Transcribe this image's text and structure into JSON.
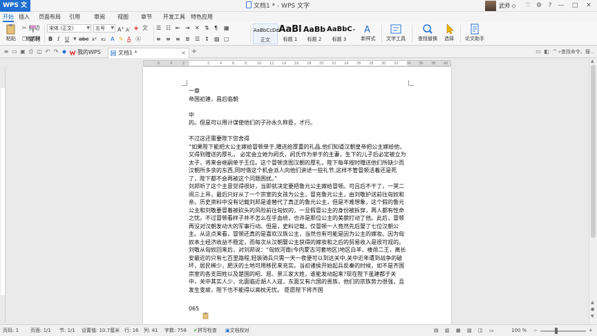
{
  "titlebar": {
    "app_menu": "WPS 文字",
    "doc_title": "文档1 * - WPS 文字",
    "username": "武师 ◇"
  },
  "menu": {
    "tabs": [
      "开始",
      "插入",
      "页面布局",
      "引用",
      "审阅",
      "视图",
      "章节",
      "开发工具",
      "特色应用"
    ],
    "active_index": 0
  },
  "ribbon": {
    "paste_label": "粘贴",
    "cut_label": "剪切",
    "copy_label": "复制",
    "format_painter_label": "格式刷",
    "font_name": "宋体 (正文)",
    "font_size": "五号",
    "styles": [
      {
        "sample": "AaBbCcDd",
        "label": "正文"
      },
      {
        "sample": "AaBl",
        "label": "标题 1"
      },
      {
        "sample": "AaBb",
        "label": "标题 2"
      },
      {
        "sample": "AaBbC",
        "label": "标题 3"
      }
    ],
    "new_style_label": "新样式",
    "text_tools_label": "文字工具",
    "find_replace_label": "查找替换",
    "select_label": "选择",
    "essay_assistant_label": "论文助手"
  },
  "tabs": {
    "my_wps": "我的WPS",
    "doc_tab": "文档1 *",
    "search_cmd": "查找命令、搜..."
  },
  "document": {
    "lines": [
      "一章",
      "帝国初建，昌后临朝",
      "",
      "中",
      "的。但是可以用计谋使他们的子孙永久称臣，才行。",
      "",
      "不过这还需要陛下您舍得",
      "“如果陛下能把大公主嫁给冒顿单于,赠送给厚重的礼品,他们知道汉朝皇帝把公主嫁给他，又得到赠送的厚礼， 必定会立她为阏氏，阏氏作为单于的主妻，生下的儿子后必定被立为太子，将来会继嗣单于王位。这个冒顿贪图汉朝的厚礼，陛下每年按时赠送他们所缺少而汉朝所多余的东西,同时借这个机会派人向他们讲述一些礼节,这样不管冒顿活着还是死了，陛下都不会再被这个问题困扰。”",
      "刘邦听了这个主意觉得很好，当即就决定要把鲁元公主嫁给冒顿。可吕后不干了，一哭二闹三上吊，最后只好从了一个宗室的女孩为公主，冒充鲁元公主，由刘敬护送前往匈奴和亲。历史资料中没有记载刘邦是谁替代了真正的鲁元公主，但是不难想象，这个假的鲁元公主和刘敬要冒着被砍头的风险前往匈奴的，一旦假冒公主的身份被拆穿，两人都有性命之忧。不过冒顿看样子并不怎么在乎血统，也许是那位公主的美貌打动了他。此后，冒顿再没对汉朝发动大的军事行动。但是，史料记载，仅冒顿一人竟然先后娶了七位汉朝公主。从这点来看，冒顿还真的是喜欢汉族公主，当然也有可能是因为公主的嫁妆。因为匈奴本土经济收益不稳定，而每次从汉朝娶公主获得的嫁妆和之后的贸易收入是很可观的。",
      "刘敬从匈奴回来后，对刘邦说：“匈奴河南(今内蒙古河套地区)地区白羊、楼烦二王，离长安最近的只有七百里路程,轻装骑兵只需一天一夜便可以到达关中,关中近年遭到战争的破坏，居民稀少，肥沃的土地可用移民来充实。当初诸侯开始起兵反秦的时候，如不是齐国宗室的各支田姓以及楚国的昭、屈、景三家大姓，谁能发动起来?现在陛下虽建都于关中，关中其实人少，北面临近胡人人寇，东面又有六国的贵族，他们的宗族势力很强，且发生变故，陛下也不能得以高枕无忧。 臣愿陛下将齐国"
    ],
    "page_number": "065"
  },
  "status": {
    "page": "页码: 1",
    "pages": "页面: 1/1",
    "section": "节: 1/1",
    "setting": "设置值: 10.7厘米",
    "row": "行: 16",
    "col": "列: 41",
    "words": "字数: 758",
    "spell": "拼写检查",
    "proofread": "文档校对",
    "zoom": "100 %"
  },
  "colors": {
    "accent": "#1e6fd1",
    "page_bg": "#ffffff",
    "workspace": "#eaeaea"
  }
}
